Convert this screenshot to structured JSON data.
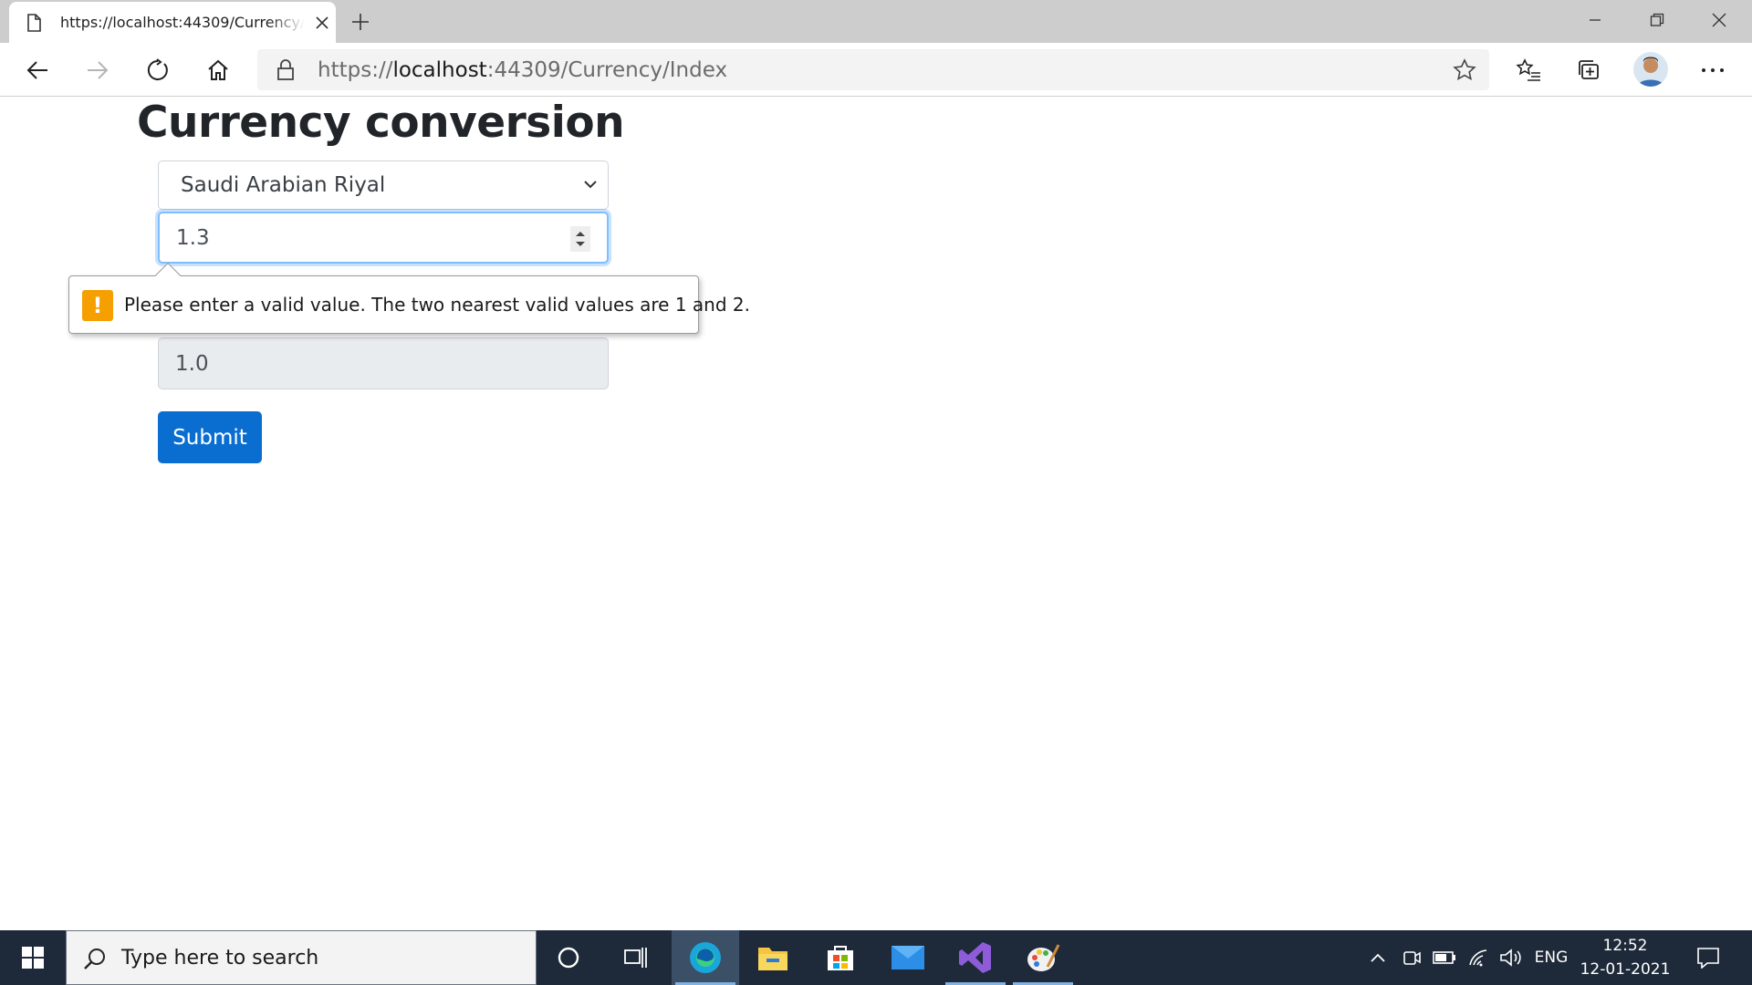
{
  "browser": {
    "tab_title": "https://localhost:44309/Currency/Index",
    "url_scheme": "https://",
    "url_host": "localhost",
    "url_rest": ":44309/Currency/Index"
  },
  "page": {
    "title": "Currency conversion",
    "currency_select": {
      "selected": "Saudi Arabian Riyal"
    },
    "amount_input": {
      "value": "1.3"
    },
    "validation_message": "Please enter a valid value. The two nearest valid values are 1 and 2.",
    "result_field": {
      "value": "1.0"
    },
    "submit_label": "Submit"
  },
  "taskbar": {
    "search_placeholder": "Type here to search",
    "language": "ENG",
    "time": "12:52",
    "date": "12-01-2021",
    "apps": [
      "cortana-icon",
      "task-view-icon",
      "edge-icon",
      "file-explorer-icon",
      "store-icon",
      "mail-icon",
      "visual-studio-icon",
      "paint-icon"
    ]
  },
  "colors": {
    "accent": "#0a6ed1",
    "focus_border": "#80bdff",
    "warning": "#f59f00",
    "taskbar": "#1e2a3a"
  }
}
